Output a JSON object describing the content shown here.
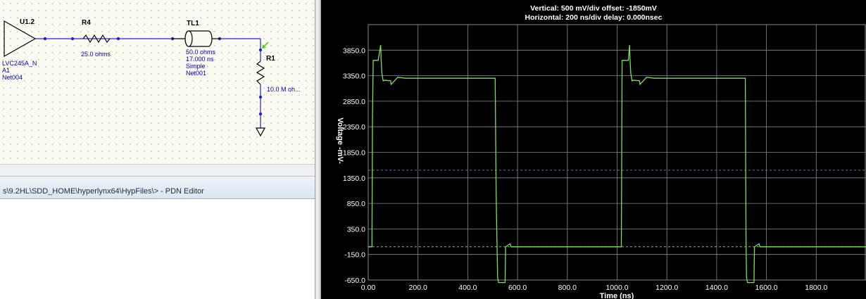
{
  "schematic": {
    "u1": {
      "ref": "U1.2",
      "model": "LVC245A_N",
      "pin": "A1",
      "net": "Net004"
    },
    "r4": {
      "ref": "R4",
      "value": "25.0 ohms"
    },
    "tl1": {
      "ref": "TL1",
      "impedance": "50.0 ohms",
      "delay": "17.000 ns",
      "type": "Simple",
      "net": "Net001"
    },
    "r1": {
      "ref": "R1",
      "value": "10.0 M oh..."
    },
    "colors": {
      "wire": "#2222cc",
      "part": "#000000",
      "label_blue": "#0000aa",
      "probe": "#55cc22"
    }
  },
  "pdn_window": {
    "title": "s\\9.2HL\\SDD_HOME\\hyperlynx64\\HypFiles\\> - PDN Editor"
  },
  "scope": {
    "header_line1": "Vertical: 500 mV/div  offset: -1850mV",
    "header_line2": "Horizontal: 200 ns/div  delay: 0.000nsec",
    "ylabel": "Voltage -mV-",
    "xlabel": "Time (ns)",
    "colors": {
      "trace": "#7ee05a",
      "grid": "#8a8a8a",
      "ref_dashed": "#6a6ab8",
      "zero_dashed": "#5fd25f",
      "text": "#ffffff"
    }
  },
  "chart_data": {
    "type": "line",
    "title": "",
    "xlabel": "Time (ns)",
    "ylabel": "Voltage -mV-",
    "xlim": [
      0,
      2000
    ],
    "ylim": [
      -650,
      4350
    ],
    "xticks": [
      0,
      200,
      400,
      600,
      800,
      1000,
      1200,
      1400,
      1600,
      1800
    ],
    "xtick_labels": [
      "0.00",
      "200.0",
      "400.0",
      "600.0",
      "800.0",
      "1000.0",
      "1200.0",
      "1400.0",
      "1600.0",
      "1800.0"
    ],
    "yticks": [
      3850,
      3350,
      2850,
      2350,
      1850,
      1350,
      850,
      350,
      -150,
      -650
    ],
    "ytick_labels": [
      "3850.0",
      "3350.0",
      "2850.0",
      "2350.0",
      "1850.0",
      "1350.0",
      "850.0",
      "350.0",
      "-150.0",
      "-650.0"
    ],
    "grid": true,
    "reference_lines": [
      {
        "y": 1500,
        "style": "dashed"
      },
      {
        "y": 0,
        "style": "dashed"
      }
    ],
    "series": [
      {
        "x": [
          0,
          15,
          17,
          20,
          40,
          50,
          52,
          55,
          60,
          65,
          90,
          92,
          115,
          118,
          150,
          510,
          514,
          517,
          520,
          524,
          550,
          552,
          570,
          574,
          590,
          1000,
          1017,
          1020,
          1045,
          1050,
          1052,
          1055,
          1060,
          1065,
          1090,
          1092,
          1115,
          1118,
          1150,
          1515,
          1518,
          1520,
          1524,
          1550,
          1552,
          1570,
          1574,
          1590,
          2000
        ],
        "y": [
          0,
          0,
          2500,
          3650,
          3650,
          3950,
          3650,
          3400,
          3250,
          3260,
          3250,
          3180,
          3300,
          3320,
          3300,
          3300,
          1000,
          150,
          -600,
          -700,
          -700,
          0,
          60,
          0,
          0,
          0,
          0,
          3650,
          3650,
          3950,
          3650,
          3400,
          3250,
          3260,
          3250,
          3180,
          3300,
          3320,
          3300,
          3300,
          150,
          -600,
          -700,
          -700,
          0,
          60,
          0,
          0,
          0
        ]
      }
    ]
  }
}
